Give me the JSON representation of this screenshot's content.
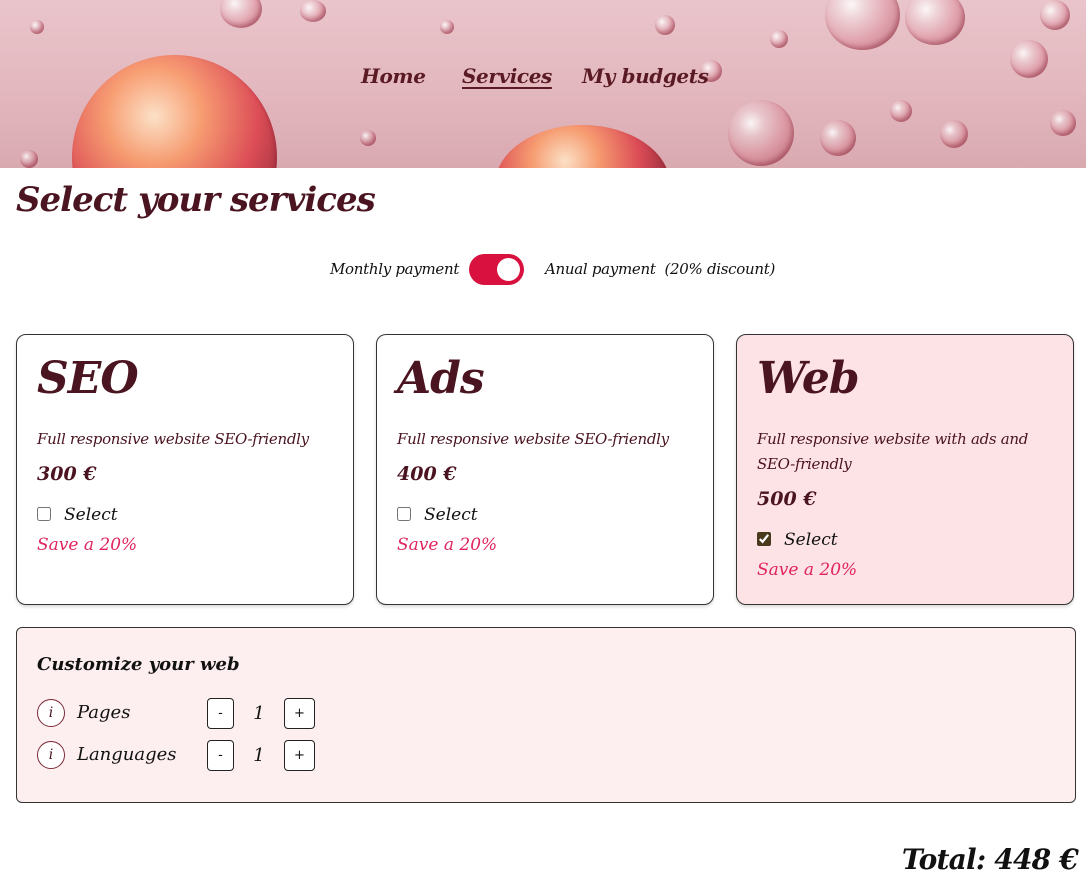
{
  "nav": {
    "items": [
      {
        "label": "Home",
        "active": false
      },
      {
        "label": "Services",
        "active": true
      },
      {
        "label": "My budgets",
        "active": false
      }
    ]
  },
  "page_title": "Select your services",
  "billing": {
    "left_label": "Monthly payment",
    "right_label": "Anual payment  (20% discount)",
    "annual_selected": true
  },
  "services": [
    {
      "name": "SEO",
      "description": "Full responsive website SEO-friendly",
      "price": "300 €",
      "select_label": "Select",
      "checked": false,
      "save": "Save a 20%"
    },
    {
      "name": "Ads",
      "description": "Full responsive website SEO-friendly",
      "price": "400 €",
      "select_label": "Select",
      "checked": false,
      "save": "Save a 20%"
    },
    {
      "name": "Web",
      "description": "Full responsive website with ads and SEO-friendly",
      "price": "500 €",
      "select_label": "Select",
      "checked": true,
      "save": "Save a 20%"
    }
  ],
  "customize": {
    "title": "Customize your web",
    "options": [
      {
        "label": "Pages",
        "value": "1",
        "info_icon": "i",
        "minus": "-",
        "plus": "+"
      },
      {
        "label": "Languages",
        "value": "1",
        "info_icon": "i",
        "minus": "-",
        "plus": "+"
      }
    ]
  },
  "total": "Total: 448 €",
  "colors": {
    "accent": "#d8113f",
    "heading": "#4a1420",
    "save_text": "#e0245e",
    "selected_card_bg": "#fde3e5",
    "panel_bg": "#fdeeef"
  }
}
